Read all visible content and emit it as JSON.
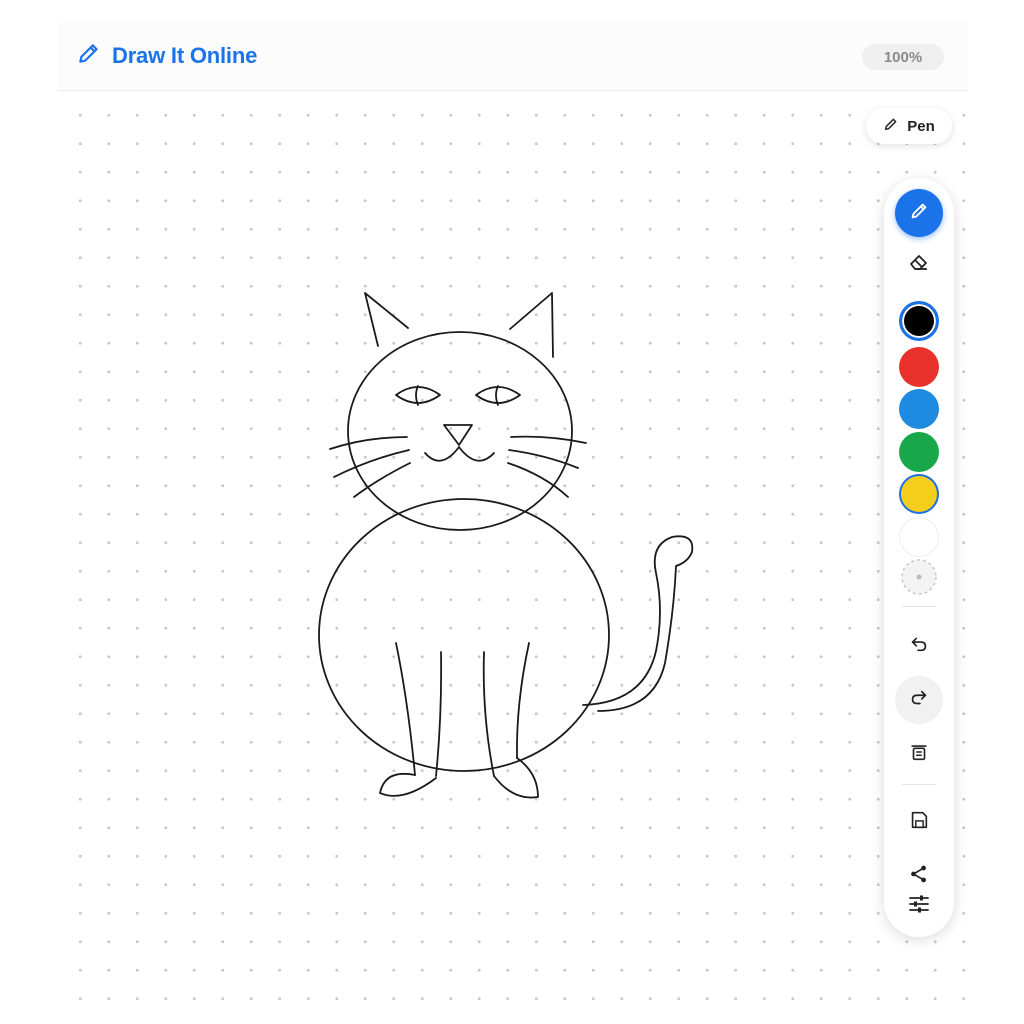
{
  "app": {
    "title": "Draw It Online",
    "zoom_label": "100%",
    "brand_icon": "pencil-icon"
  },
  "tool_indicator": {
    "label": "Pen",
    "icon": "pencil-icon"
  },
  "toolbar": {
    "tools": [
      {
        "name": "pen",
        "icon": "pencil-icon",
        "active": true
      },
      {
        "name": "eraser",
        "icon": "eraser-icon",
        "active": false
      }
    ],
    "colors": [
      {
        "name": "black",
        "hex": "#000000",
        "selected": true
      },
      {
        "name": "red",
        "hex": "#e8312a",
        "selected": false
      },
      {
        "name": "blue",
        "hex": "#1e8ae0",
        "selected": false
      },
      {
        "name": "green",
        "hex": "#18a84a",
        "selected": false
      },
      {
        "name": "yellow",
        "hex": "#f5cf1c",
        "selected": false
      },
      {
        "name": "white",
        "hex": "#ffffff",
        "selected": false
      }
    ],
    "custom_color_icon": "custom-color-icon",
    "actions": [
      {
        "name": "undo",
        "icon": "undo-icon"
      },
      {
        "name": "redo",
        "icon": "redo-icon"
      },
      {
        "name": "clear",
        "icon": "trash-icon"
      },
      {
        "name": "save",
        "icon": "save-icon"
      },
      {
        "name": "share",
        "icon": "share-icon"
      },
      {
        "name": "settings",
        "icon": "sliders-icon"
      }
    ]
  },
  "theme": {
    "accent": "#1a73e8",
    "stroke": "#1a1a1a",
    "dot": "#c6c6c6"
  }
}
